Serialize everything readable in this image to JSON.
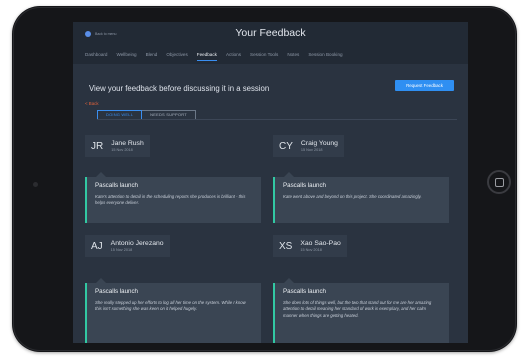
{
  "app": {
    "logo_text": "Back to menu",
    "title": "Your Feedback"
  },
  "nav": [
    {
      "label": "Dashboard",
      "active": false
    },
    {
      "label": "Wellbeing",
      "active": false
    },
    {
      "label": "Blend",
      "active": false
    },
    {
      "label": "Objectives",
      "active": false
    },
    {
      "label": "Feedback",
      "active": true
    },
    {
      "label": "Actions",
      "active": false
    },
    {
      "label": "Session Tools",
      "active": false
    },
    {
      "label": "Notes",
      "active": false
    },
    {
      "label": "Session Booking",
      "active": false
    }
  ],
  "header": {
    "intro": "View your feedback before discussing it in a session",
    "request_button": "Request Feedback",
    "back_link": "< Back"
  },
  "tabs": [
    {
      "label": "DOING WELL",
      "active": true
    },
    {
      "label": "NEEDS SUPPORT",
      "active": false
    }
  ],
  "colors": {
    "accent": "#3a8ef0",
    "highlight": "#32c8a3",
    "back_link": "#e0623b"
  },
  "cards": [
    {
      "initials": "JR",
      "name": "Jane Rush",
      "date": "15 Nov 2018",
      "title": "Pascalls launch",
      "text": "Kate's attention to detail in the scheduling reports she produces is brilliant - this helps everyone deliver."
    },
    {
      "initials": "CY",
      "name": "Craig Young",
      "date": "15 Nov 2018",
      "title": "Pascalls launch",
      "text": "Kate went above and beyond on this project. She coordinated amazingly."
    },
    {
      "initials": "AJ",
      "name": "Antonio Jerezano",
      "date": "15 Nov 2018",
      "title": "Pascalls launch",
      "text": "She really stepped up her efforts to log all her time on the system. While I know this isn't something she was keen on it helped hugely."
    },
    {
      "initials": "XS",
      "name": "Xao Sao-Pao",
      "date": "15 Nov 2018",
      "title": "Pascalls launch",
      "text": "She does lots of things well, but the two that stand out for me are her amazing attention to detail meaning her standard of work is exemplary, and her calm manner when things are getting heated."
    }
  ]
}
